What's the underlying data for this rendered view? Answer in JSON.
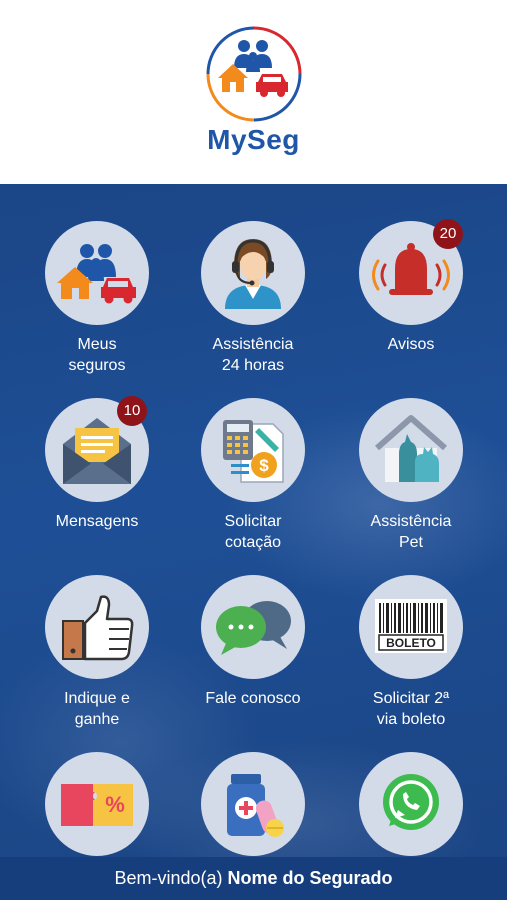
{
  "app": {
    "brand": "MySeg"
  },
  "menu": [
    {
      "id": "meus-seguros",
      "lines": [
        "Meus",
        "seguros"
      ],
      "icon": "family-house-car-icon"
    },
    {
      "id": "assistencia-24h",
      "lines": [
        "Assistência",
        "24 horas"
      ],
      "icon": "headset-agent-icon"
    },
    {
      "id": "avisos",
      "lines": [
        "Avisos"
      ],
      "icon": "alarm-bell-icon",
      "badge": "20"
    },
    {
      "id": "mensagens",
      "lines": [
        "Mensagens"
      ],
      "icon": "envelope-icon",
      "badge": "10"
    },
    {
      "id": "solicitar-cotacao",
      "lines": [
        "Solicitar",
        "cotação"
      ],
      "icon": "calculator-quote-icon"
    },
    {
      "id": "assistencia-pet",
      "lines": [
        "Assistência",
        "Pet"
      ],
      "icon": "pet-house-icon"
    },
    {
      "id": "indique-e-ganhe",
      "lines": [
        "Indique e",
        "ganhe"
      ],
      "icon": "thumbs-up-icon"
    },
    {
      "id": "fale-conosco",
      "lines": [
        "Fale conosco"
      ],
      "icon": "chat-bubbles-icon"
    },
    {
      "id": "segunda-via-boleto",
      "lines": [
        "Solicitar 2ª",
        "via boleto"
      ],
      "icon": "barcode-boleto-icon",
      "icon_text": "BOLETO"
    },
    {
      "id": "cupons",
      "lines": [],
      "icon": "discount-coupon-icon",
      "icon_text": "%"
    },
    {
      "id": "medicamentos",
      "lines": [],
      "icon": "medicine-pills-icon"
    },
    {
      "id": "whatsapp",
      "lines": [],
      "icon": "whatsapp-icon"
    }
  ],
  "footer": {
    "greeting": "Bem-vindo(a)",
    "user_name": "Nome do Segurado"
  },
  "colors": {
    "brand_blue": "#1f56a8",
    "background_blue": "#1e4f96",
    "tile_circle": "#d3dbe9",
    "badge": "#8f1419",
    "accent_orange": "#f28a1c",
    "accent_red": "#d8272f",
    "whatsapp_green": "#3dbb4f"
  }
}
